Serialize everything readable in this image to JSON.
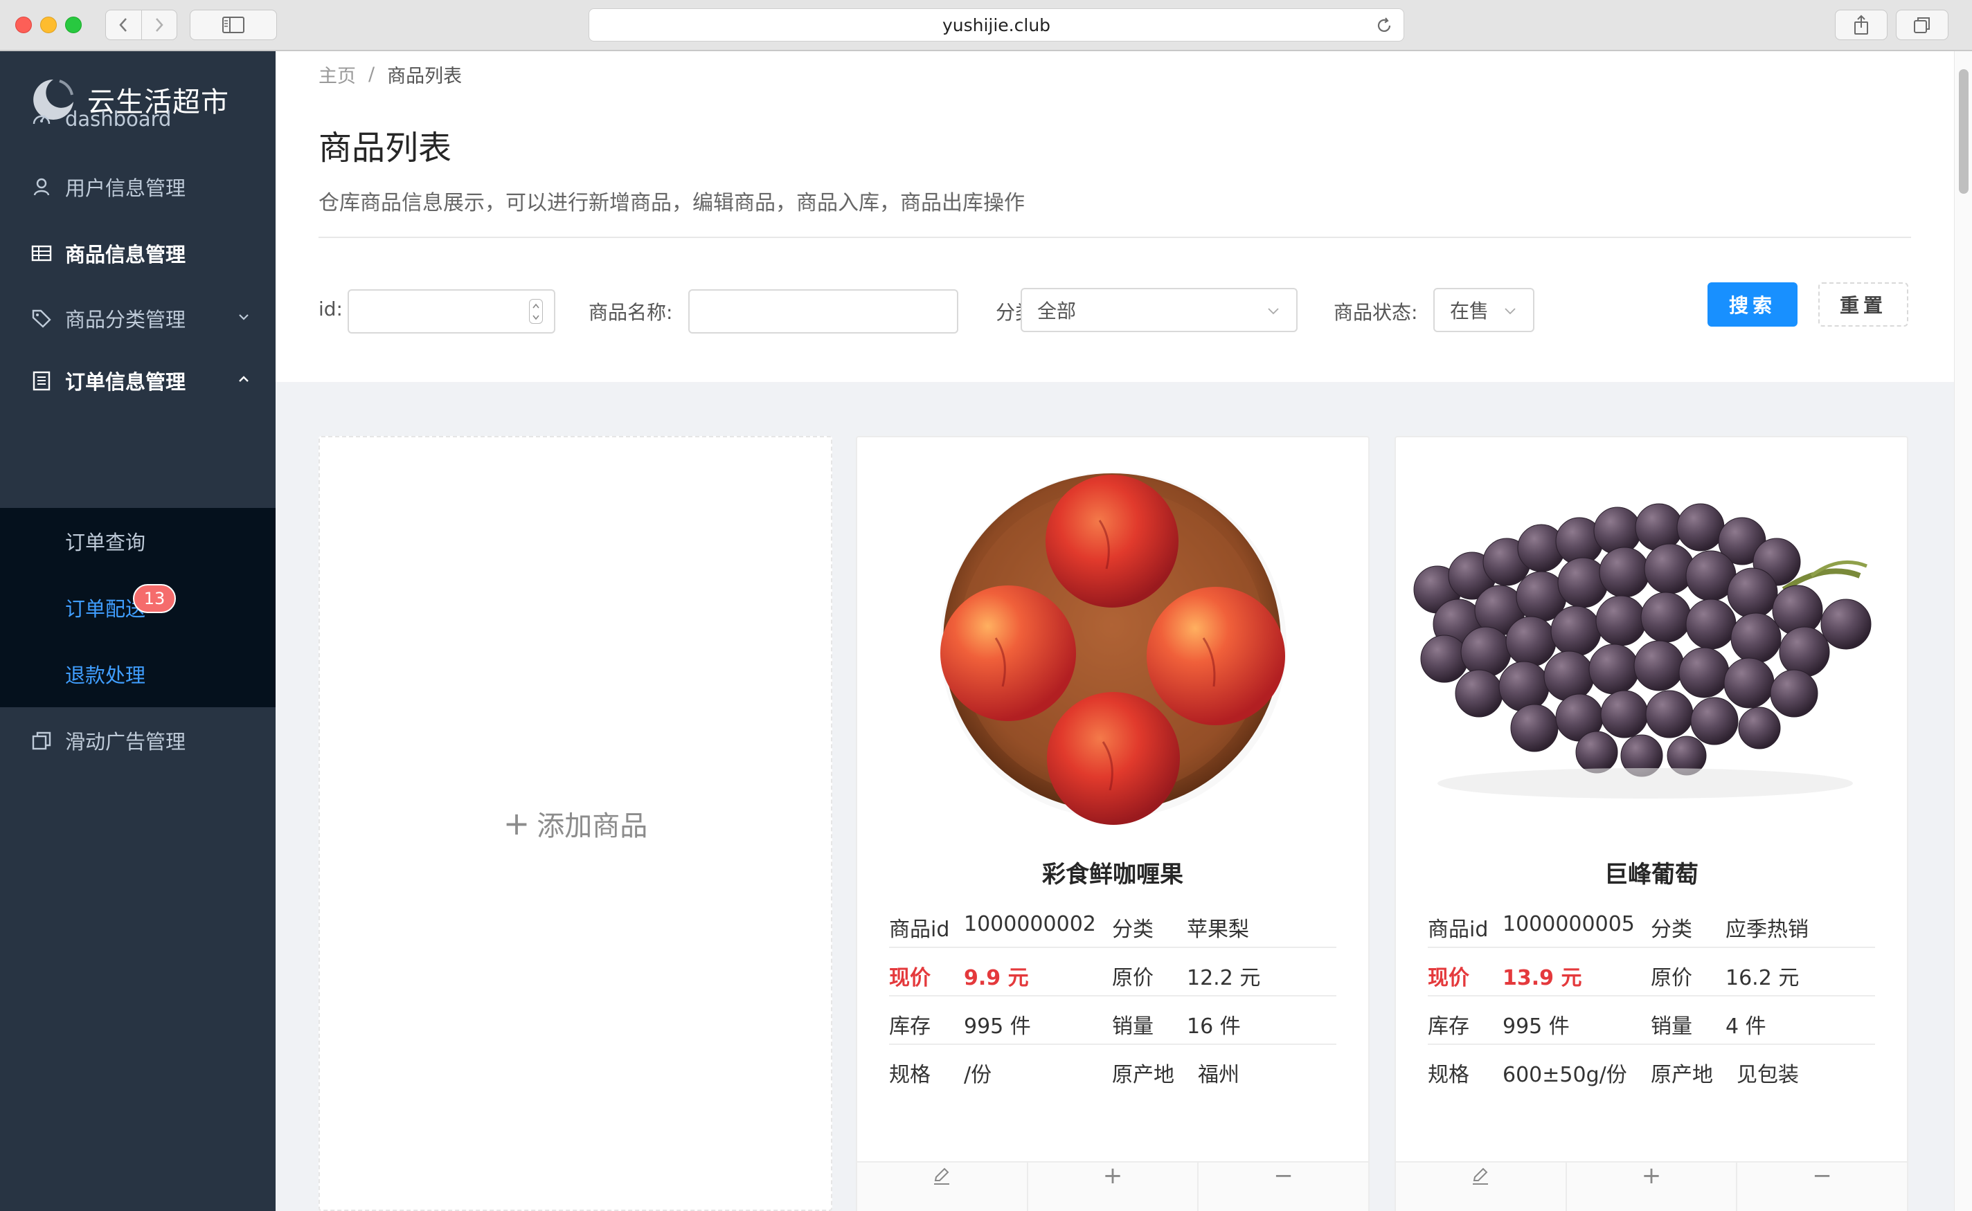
{
  "browser": {
    "url": "yushijie.club"
  },
  "sidebar": {
    "brand": "云生活超市",
    "items": [
      {
        "label": "dashboard",
        "icon": "dashboard-icon"
      },
      {
        "label": "用户信息管理",
        "icon": "user-icon"
      },
      {
        "label": "商品信息管理",
        "icon": "table-icon"
      },
      {
        "label": "商品分类管理",
        "icon": "tag-icon"
      },
      {
        "label": "订单信息管理",
        "icon": "list-icon"
      },
      {
        "label": "滑动广告管理",
        "icon": "copy-icon"
      }
    ],
    "submenu": [
      {
        "label": "订单查询"
      },
      {
        "label": "订单配送",
        "badge": "13"
      },
      {
        "label": "退款处理"
      }
    ]
  },
  "breadcrumb": {
    "home": "主页",
    "separator": "/",
    "current": "商品列表"
  },
  "page": {
    "title": "商品列表",
    "description": "仓库商品信息展示，可以进行新增商品，编辑商品，商品入库，商品出库操作"
  },
  "filters": {
    "id_label": "id:",
    "id_value": "",
    "name_label": "商品名称:",
    "name_value": "",
    "category_label": "分类",
    "category_value": "全部",
    "status_label": "商品状态:",
    "status_value": "在售",
    "search_button": "搜索",
    "reset_button": "重置"
  },
  "add_card": {
    "plus": "+",
    "label": "添加商品"
  },
  "products": [
    {
      "name": "彩食鲜咖喱果",
      "id_label": "商品id",
      "id": "1000000002",
      "category_label": "分类",
      "category": "苹果梨",
      "price_label": "现价",
      "price": "9.9 元",
      "original_label": "原价",
      "original": "12.2 元",
      "stock_label": "库存",
      "stock": "995 件",
      "sales_label": "销量",
      "sales": "16 件",
      "spec_label": "规格",
      "spec": "/份",
      "origin_label": "原产地",
      "origin": "福州",
      "image": "peaches-in-bowl"
    },
    {
      "name": "巨峰葡萄",
      "id_label": "商品id",
      "id": "1000000005",
      "category_label": "分类",
      "category": "应季热销",
      "price_label": "现价",
      "price": "13.9 元",
      "original_label": "原价",
      "original": "16.2 元",
      "stock_label": "库存",
      "stock": "995 件",
      "sales_label": "销量",
      "sales": "4 件",
      "spec_label": "规格",
      "spec": "600±50g/份",
      "origin_label": "原产地",
      "origin": "见包装",
      "image": "grape-bunch"
    }
  ],
  "card_actions": {
    "edit": "edit-icon",
    "add": "+",
    "remove": "−"
  },
  "colors": {
    "sidebar_bg": "#283443",
    "submenu_bg": "#05111d",
    "accent": "#1890ff",
    "active_link": "#409eff",
    "price_red": "#e4393c",
    "badge_red": "#f56c6c"
  }
}
